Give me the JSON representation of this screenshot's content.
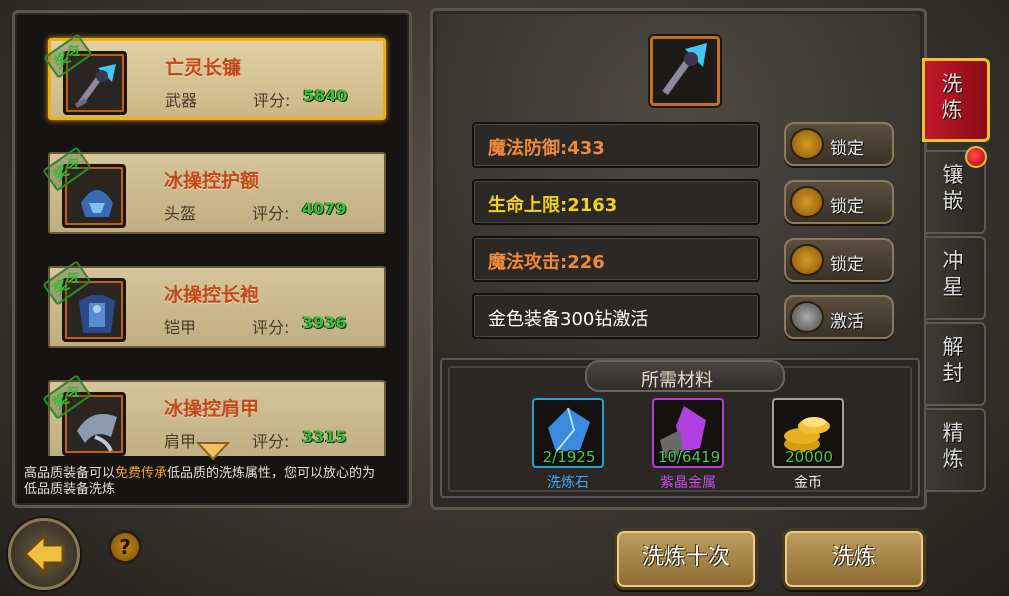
{
  "items": [
    {
      "name": "亡灵长镰",
      "type": "武器",
      "score_label": "评分:",
      "score": "5840",
      "badge": "奖令",
      "selected": true,
      "icon": "scythe-icon"
    },
    {
      "name": "冰操控护额",
      "type": "头盔",
      "score_label": "评分:",
      "score": "4079",
      "badge": "奖令",
      "selected": false,
      "icon": "helmet-icon"
    },
    {
      "name": "冰操控长袍",
      "type": "铠甲",
      "score_label": "评分:",
      "score": "3936",
      "badge": "奖令",
      "selected": false,
      "icon": "armor-icon"
    },
    {
      "name": "冰操控肩甲",
      "type": "肩甲",
      "score_label": "评分:",
      "score": "3315",
      "badge": "奖令",
      "selected": false,
      "icon": "shoulder-icon"
    }
  ],
  "hint": {
    "pre": "高品质装备可以",
    "highlight": "免费传承",
    "post": "低品质的洗炼属性，您可以放心的为低品质装备洗炼"
  },
  "attributes": [
    {
      "text": "魔法防御:433",
      "color": "#f08a3a",
      "button": "锁定"
    },
    {
      "text": "生命上限:2163",
      "color": "#f0d020",
      "button": "锁定"
    },
    {
      "text": "魔法攻击:226",
      "color": "#f08a3a",
      "button": "锁定"
    },
    {
      "text": "金色装备300钻激活",
      "color": "#ffffff",
      "button": "激活"
    }
  ],
  "materials_title": "所需材料",
  "materials": [
    {
      "name": "洗炼石",
      "count": "2/1925",
      "name_color": "#40a8f0",
      "border": "#2aa0d0"
    },
    {
      "name": "紫晶金属",
      "count": "10/6419",
      "name_color": "#c050e0",
      "border": "#b040d0"
    },
    {
      "name": "金币",
      "count": "20000",
      "name_color": "#eeeeee",
      "border": "#a0a0a0"
    }
  ],
  "tabs": [
    "洗炼",
    "镶嵌",
    "冲星",
    "解封",
    "精炼"
  ],
  "buttons": {
    "refine_ten": "洗炼十次",
    "refine": "洗炼",
    "help": "?"
  }
}
